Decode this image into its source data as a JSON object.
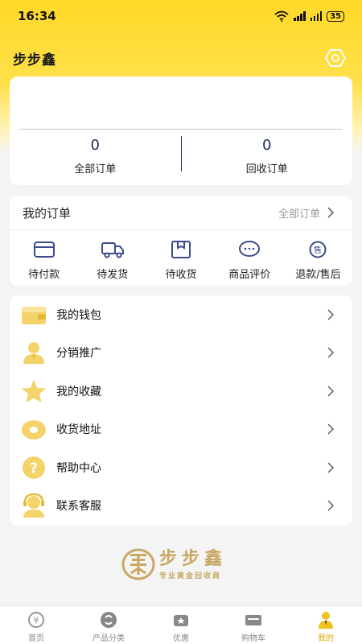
{
  "status_bar": {
    "time": "16:34",
    "battery": "35"
  },
  "header": {
    "title": "步步鑫"
  },
  "stats": [
    {
      "value": "0",
      "label": "全部订单"
    },
    {
      "value": "0",
      "label": "回收订单"
    }
  ],
  "orders": {
    "title": "我的订单",
    "all_label": "全部订单",
    "items": [
      {
        "label": "待付款",
        "icon": "wallet-card-icon"
      },
      {
        "label": "待发货",
        "icon": "truck-icon"
      },
      {
        "label": "待收货",
        "icon": "package-icon"
      },
      {
        "label": "商品评价",
        "icon": "chat-bubble-icon"
      },
      {
        "label": "退款/售后",
        "icon": "after-sale-icon"
      }
    ]
  },
  "menu": [
    {
      "label": "我的钱包",
      "icon": "wallet-icon"
    },
    {
      "label": "分销推广",
      "icon": "person-icon"
    },
    {
      "label": "我的收藏",
      "icon": "star-icon"
    },
    {
      "label": "收货地址",
      "icon": "location-icon"
    },
    {
      "label": "帮助中心",
      "icon": "question-icon"
    },
    {
      "label": "联系客服",
      "icon": "headset-icon"
    }
  ],
  "brand": {
    "name": "步步鑫",
    "slogan": "专业黄金回收商"
  },
  "tabs": [
    {
      "label": "首页",
      "icon": "home-yen-icon",
      "active": false
    },
    {
      "label": "产品分类",
      "icon": "category-icon",
      "active": false
    },
    {
      "label": "优惠",
      "icon": "discount-icon",
      "active": false
    },
    {
      "label": "购物车",
      "icon": "cart-icon",
      "active": false
    },
    {
      "label": "我的",
      "icon": "profile-icon",
      "active": true
    }
  ],
  "colors": {
    "accent": "#ffd928",
    "gold": "#c9a864",
    "active_tab": "#e0a800",
    "navy": "#1a2a5a",
    "icon_blue": "#3a4a8a"
  }
}
